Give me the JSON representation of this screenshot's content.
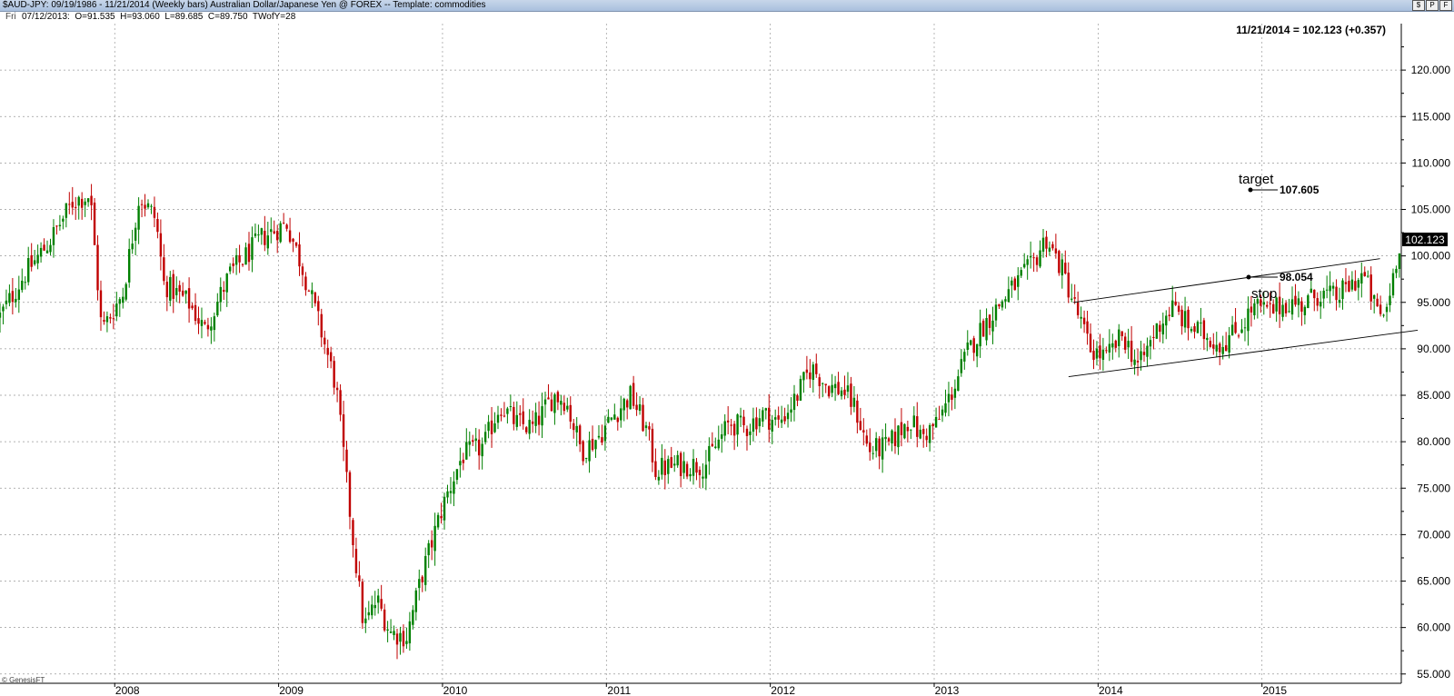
{
  "window": {
    "title": "$AUD-JPY:  09/19/1986 - 11/21/2014  (Weekly bars)   Australian Dollar/Japanese Yen @ FOREX  --  Template: commodities",
    "buttons": [
      "$",
      "P",
      "F"
    ]
  },
  "infobar": {
    "day": "Fri",
    "text": "07/12/2013:  O=91.535  H=93.060  L=89.685  C=89.750  TWofY=28"
  },
  "header_readout": "11/21/2014 = 102.123 (+0.357)",
  "current_price_label": "102.123",
  "watermark": "© GenesisFT",
  "colors": {
    "up": "#008000",
    "down": "#c00000",
    "grid": "#999999",
    "price_tag_bg": "#000000"
  },
  "annotations": {
    "target_label": "target",
    "target_value": "107.605",
    "stop_label": "stop",
    "stop_value": "98.054"
  },
  "chart_data": {
    "type": "candlestick",
    "title": "",
    "ylim": [
      54,
      125
    ],
    "xlim": [
      2007.3,
      2015.85
    ],
    "y_ticks": [
      "55.000",
      "60.000",
      "65.000",
      "70.000",
      "75.000",
      "80.000",
      "85.000",
      "90.000",
      "95.000",
      "100.000",
      "105.000",
      "110.000",
      "115.000",
      "120.000"
    ],
    "x_ticks": [
      "2008",
      "2009",
      "2010",
      "2011",
      "2012",
      "2013",
      "2014",
      "2015"
    ],
    "x_tick_values": [
      2008,
      2009,
      2010,
      2011,
      2012,
      2013,
      2014,
      2015
    ],
    "grid": true,
    "path": [
      [
        2007.3,
        93.5
      ],
      [
        2007.45,
        98.0
      ],
      [
        2007.6,
        101.5
      ],
      [
        2007.75,
        106.0
      ],
      [
        2007.85,
        106.5
      ],
      [
        2007.92,
        92.0
      ],
      [
        2008.05,
        96.0
      ],
      [
        2008.15,
        106.5
      ],
      [
        2008.25,
        104.0
      ],
      [
        2008.3,
        97.0
      ],
      [
        2008.45,
        95.0
      ],
      [
        2008.55,
        92.0
      ],
      [
        2008.7,
        98.0
      ],
      [
        2008.9,
        102.0
      ],
      [
        2009.05,
        103.5
      ],
      [
        2009.15,
        98.5
      ],
      [
        2009.25,
        92.5
      ],
      [
        2009.35,
        86.0
      ],
      [
        2009.45,
        70.0
      ],
      [
        2009.52,
        60.0
      ],
      [
        2009.6,
        63.0
      ],
      [
        2009.68,
        59.5
      ],
      [
        2009.78,
        59.0
      ],
      [
        2009.88,
        66.0
      ],
      [
        2010.0,
        73.0
      ],
      [
        2010.12,
        78.5
      ],
      [
        2010.25,
        79.5
      ],
      [
        2010.35,
        84.0
      ],
      [
        2010.45,
        82.0
      ],
      [
        2010.55,
        81.5
      ],
      [
        2010.68,
        85.0
      ],
      [
        2010.75,
        84.5
      ],
      [
        2010.85,
        79.0
      ],
      [
        2010.95,
        80.5
      ],
      [
        2011.05,
        83.0
      ],
      [
        2011.15,
        85.0
      ],
      [
        2011.25,
        81.0
      ],
      [
        2011.3,
        77.0
      ],
      [
        2011.45,
        77.5
      ],
      [
        2011.6,
        77.5
      ],
      [
        2011.75,
        82.0
      ],
      [
        2011.85,
        81.5
      ],
      [
        2011.95,
        83.0
      ],
      [
        2012.05,
        82.0
      ],
      [
        2012.15,
        84.5
      ],
      [
        2012.25,
        88.0
      ],
      [
        2012.35,
        86.0
      ],
      [
        2012.45,
        85.5
      ],
      [
        2012.52,
        83.5
      ],
      [
        2012.6,
        79.0
      ],
      [
        2012.72,
        79.5
      ],
      [
        2012.85,
        82.5
      ],
      [
        2012.92,
        80.5
      ],
      [
        2013.02,
        82.0
      ],
      [
        2013.1,
        85.0
      ],
      [
        2013.2,
        89.5
      ],
      [
        2013.3,
        92.5
      ],
      [
        2013.45,
        96.0
      ],
      [
        2013.6,
        99.0
      ],
      [
        2013.68,
        102.0
      ],
      [
        2013.78,
        98.5
      ],
      [
        2013.85,
        95.0
      ],
      [
        2013.95,
        90.0
      ],
      [
        2014.05,
        89.0
      ],
      [
        2014.15,
        91.5
      ],
      [
        2014.25,
        88.0
      ],
      [
        2014.35,
        92.0
      ],
      [
        2014.45,
        94.5
      ],
      [
        2014.55,
        92.5
      ],
      [
        2014.65,
        91.5
      ],
      [
        2014.75,
        90.5
      ],
      [
        2014.85,
        92.0
      ],
      [
        2014.95,
        94.5
      ],
      [
        2015.05,
        94.0
      ],
      [
        2015.15,
        95.0
      ],
      [
        2015.25,
        94.8
      ],
      [
        2015.35,
        96.0
      ],
      [
        2015.45,
        95.5
      ],
      [
        2015.55,
        97.0
      ],
      [
        2015.62,
        98.0
      ],
      [
        2015.7,
        94.0
      ],
      [
        2015.75,
        93.5
      ],
      [
        2015.8,
        98.0
      ],
      [
        2015.84,
        101.5
      ]
    ],
    "channel": {
      "upper": [
        [
          2013.85,
          95.0
        ],
        [
          2015.72,
          99.7
        ]
      ],
      "lower": [
        [
          2013.82,
          87.0
        ],
        [
          2015.95,
          92.0
        ]
      ]
    }
  }
}
